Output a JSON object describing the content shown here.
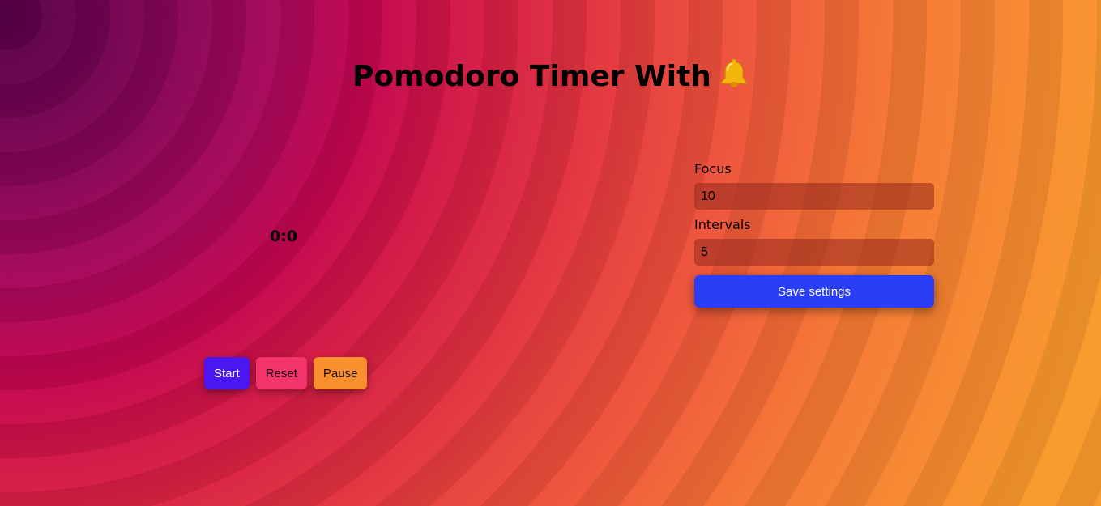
{
  "header": {
    "title": "Pomodoro Timer With",
    "title_icon": "bell-icon"
  },
  "timer": {
    "display": "0:0"
  },
  "controls": {
    "start_label": "Start",
    "reset_label": "Reset",
    "pause_label": "Pause"
  },
  "settings": {
    "focus_label": "Focus",
    "focus_value": "10",
    "intervals_label": "Intervals",
    "intervals_value": "5",
    "save_label": "Save settings"
  },
  "colors": {
    "start_button": "#4a17f2",
    "reset_button": "#f2346a",
    "pause_button": "#fa8f2e",
    "save_button": "#2b3ef7"
  }
}
